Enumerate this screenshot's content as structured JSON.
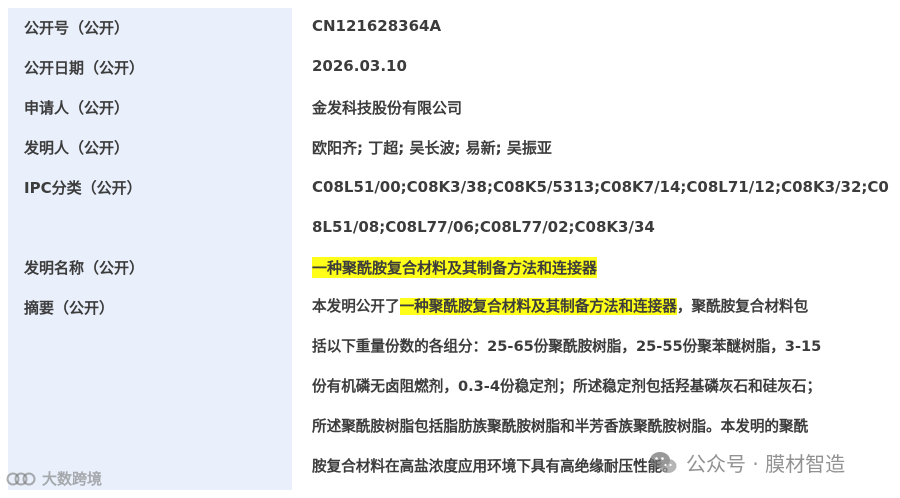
{
  "fields": [
    {
      "label": "公开号（公开）",
      "value": "CN121628364A"
    },
    {
      "label": "公开日期（公开）",
      "value": "2026.03.10"
    },
    {
      "label": "申请人（公开）",
      "value": "金发科技股份有限公司"
    },
    {
      "label": "发明人（公开）",
      "value": "欧阳齐; 丁超; 吴长波; 易新; 吴振亚"
    }
  ],
  "ipc": {
    "label": "IPC分类（公开）",
    "lines": [
      "C08L51/00;C08K3/38;C08K5/5313;C08K7/14;C08L71/12;C08K3/32;C0",
      "8L51/08;C08L77/06;C08L77/02;C08K3/34"
    ]
  },
  "title_field": {
    "label": "发明名称（公开）",
    "value": "一种聚酰胺复合材料及其制备方法和连接器"
  },
  "abstract": {
    "label": "摘要（公开）",
    "first_prefix": "本发明公开了",
    "first_highlight": "一种聚酰胺复合材料及其制备方法和连接器",
    "first_suffix": "，聚酰胺复合材料包",
    "lines": [
      "括以下重量份数的各组分：25-65份聚酰胺树脂，25-55份聚苯醚树脂，3-15",
      "份有机磷无卤阻燃剂，0.3-4份稳定剂；所述稳定剂包括羟基磷灰石和硅灰石；",
      "所述聚酰胺树脂包括脂肪族聚酰胺树脂和半芳香族聚酰胺树脂。本发明的聚酰",
      "胺复合材料在高盐浓度应用环境下具有高绝缘耐压性能。"
    ]
  },
  "watermarks": {
    "left_text": "大数跨境",
    "left_icon": "chain-logo-icon",
    "right_text": "公众号 · 膜材智造",
    "right_icon": "wechat-icon"
  },
  "colors": {
    "label_bg": "#e9f0fb",
    "highlight": "#ffff1a"
  }
}
